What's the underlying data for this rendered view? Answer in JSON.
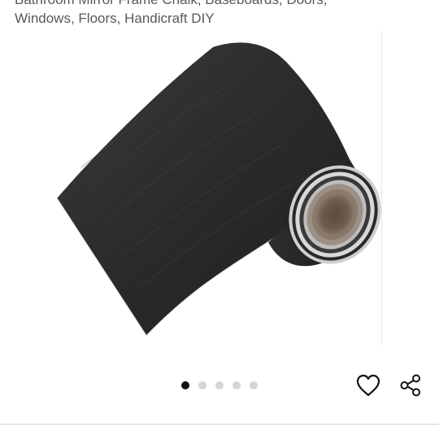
{
  "product": {
    "title_lines": [
      "Bathroom Mirror Frame Chalk, Baseboards, Doors,",
      "Windows, Floors, Handicraft DIY"
    ]
  },
  "gallery": {
    "image_icon": "black-wood-grain-tape-roll",
    "image_count": 5,
    "active_index": 0
  },
  "actions": {
    "favorite_icon": "heart-outline-icon",
    "share_icon": "share-icon"
  },
  "colors": {
    "title_text": "#565959",
    "dot_active": "#111111",
    "dot_inactive": "#d5d5d5",
    "icon": "#111111",
    "divider": "#e3e6e6"
  }
}
